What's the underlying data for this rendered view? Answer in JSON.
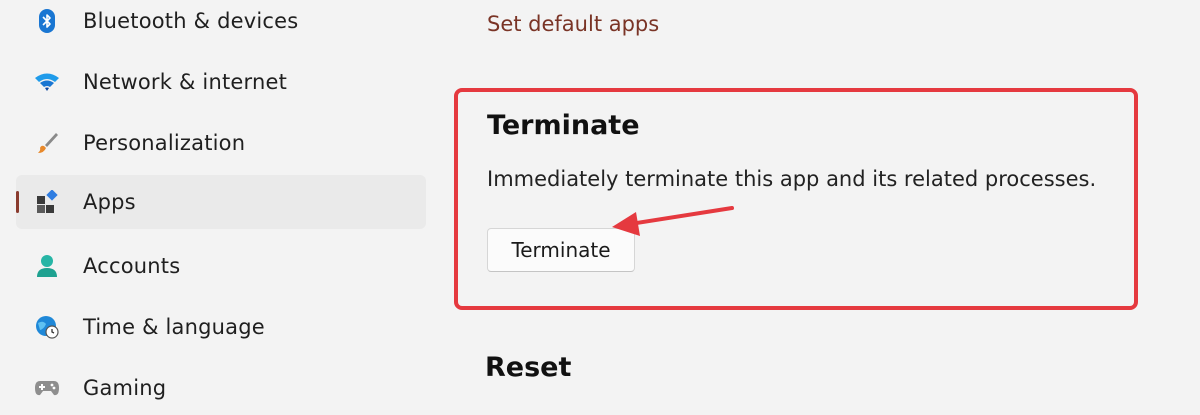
{
  "sidebar": {
    "items": [
      {
        "label": "Bluetooth & devices",
        "icon": "bluetooth-icon",
        "selected": false
      },
      {
        "label": "Network & internet",
        "icon": "wifi-icon",
        "selected": false
      },
      {
        "label": "Personalization",
        "icon": "brush-icon",
        "selected": false
      },
      {
        "label": "Apps",
        "icon": "apps-icon",
        "selected": true
      },
      {
        "label": "Accounts",
        "icon": "person-icon",
        "selected": false
      },
      {
        "label": "Time & language",
        "icon": "globe-clock-icon",
        "selected": false
      },
      {
        "label": "Gaming",
        "icon": "gamepad-icon",
        "selected": false
      }
    ],
    "accent_color": "#8a3b2e"
  },
  "main": {
    "set_default_link": "Set default apps",
    "terminate_section": {
      "title": "Terminate",
      "description": "Immediately terminate this app and its related processes.",
      "button_label": "Terminate"
    },
    "reset_section": {
      "title": "Reset"
    }
  },
  "annotation": {
    "highlight_color": "#e5393f",
    "arrow_color": "#e5393f"
  }
}
